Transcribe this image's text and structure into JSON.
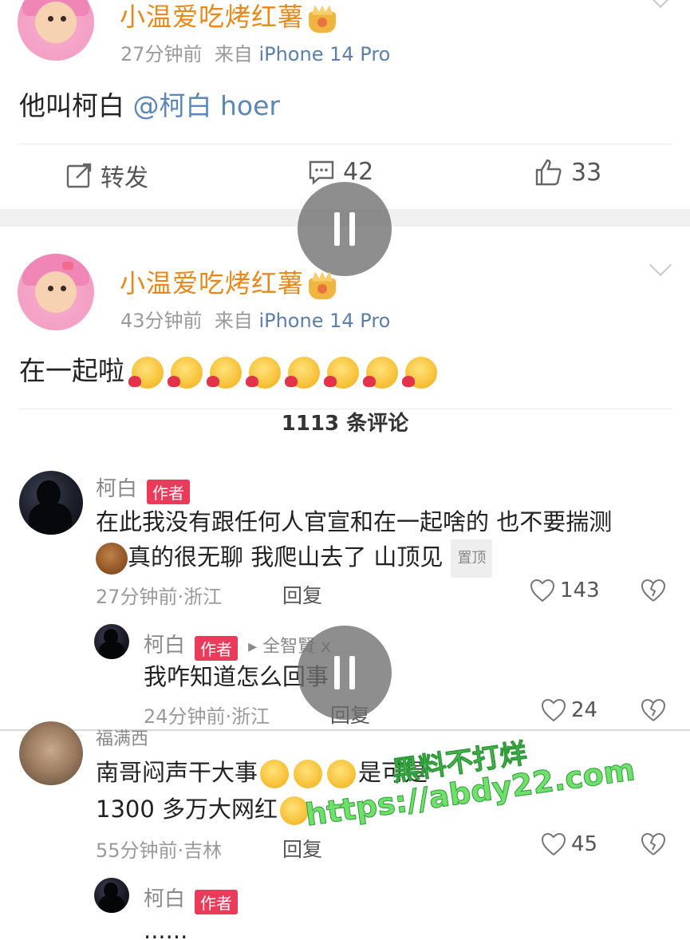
{
  "post1": {
    "username": "小温爱吃烤红薯",
    "time": "27分钟前",
    "from": "来自",
    "device": "iPhone 14 Pro",
    "text": "他叫柯白",
    "mention": "@柯白 hoer",
    "actions": {
      "repost": "转发",
      "comments": "42",
      "likes": "33"
    }
  },
  "post2": {
    "username": "小温爱吃烤红薯",
    "time": "43分钟前",
    "from": "来自",
    "device": "iPhone 14 Pro",
    "text": "在一起啦"
  },
  "comments_header": "1113 条评论",
  "comments": [
    {
      "name": "柯白",
      "badge": "作者",
      "line1": "在此我没有跟任何人官宣和在一起啥的 也不要揣测",
      "line2": "真的很无聊 我爬山去了 山顶见",
      "pin": "置顶",
      "time": "27分钟前·浙江",
      "reply": "回复",
      "likes": "143"
    },
    {
      "name": "柯白",
      "badge": "作者",
      "reply_to": "▸ 全智賢 x",
      "text": "我咋知道怎么回事",
      "time": "24分钟前·浙江",
      "reply": "回复",
      "likes": "24"
    },
    {
      "name": "福满西",
      "line1": "南哥闷声干大事",
      "line1_tail": "是可是",
      "line2": "1300 多万大网红",
      "time": "55分钟前·吉林",
      "reply": "回复",
      "likes": "45"
    },
    {
      "name": "柯白",
      "badge": "作者",
      "text": "......"
    }
  ],
  "watermark": {
    "line1": "黑料不打烊",
    "line2": "https://abdy22.com"
  },
  "colors": {
    "username": "#e8881a",
    "mention": "#5b86b8",
    "badge": "#ea3b5a",
    "watermark": "#6fe06a"
  }
}
